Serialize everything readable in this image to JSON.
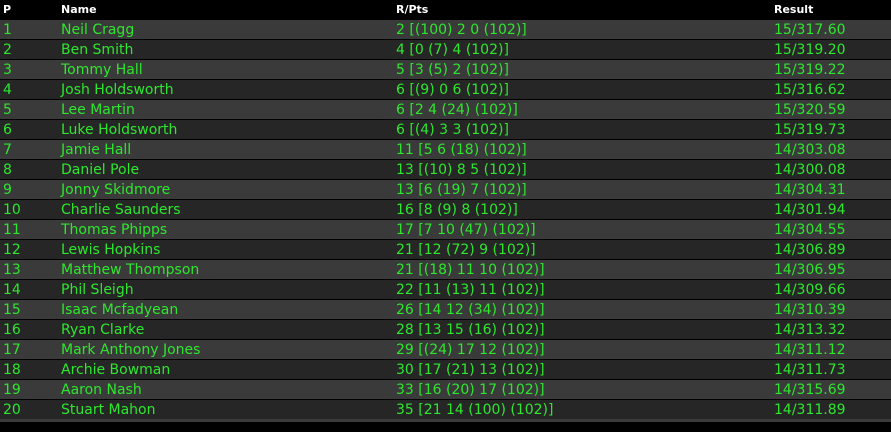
{
  "headers": {
    "pos": "P",
    "name": "Name",
    "pts": "R/Pts",
    "result": "Result"
  },
  "rows": [
    {
      "pos": "1",
      "name": "Neil Cragg",
      "pts": "2 [(100) 2 0 (102)]",
      "result": "15/317.60"
    },
    {
      "pos": "2",
      "name": "Ben Smith",
      "pts": "4 [0 (7) 4 (102)]",
      "result": "15/319.20"
    },
    {
      "pos": "3",
      "name": "Tommy Hall",
      "pts": "5 [3 (5) 2 (102)]",
      "result": "15/319.22"
    },
    {
      "pos": "4",
      "name": "Josh Holdsworth",
      "pts": "6 [(9) 0 6 (102)]",
      "result": "15/316.62"
    },
    {
      "pos": "5",
      "name": "Lee Martin",
      "pts": "6 [2 4 (24) (102)]",
      "result": "15/320.59"
    },
    {
      "pos": "6",
      "name": "Luke Holdsworth",
      "pts": "6 [(4) 3 3 (102)]",
      "result": "15/319.73"
    },
    {
      "pos": "7",
      "name": "Jamie Hall",
      "pts": "11 [5 6 (18) (102)]",
      "result": "14/303.08"
    },
    {
      "pos": "8",
      "name": "Daniel Pole",
      "pts": "13 [(10) 8 5 (102)]",
      "result": "14/300.08"
    },
    {
      "pos": "9",
      "name": "Jonny Skidmore",
      "pts": "13 [6 (19) 7 (102)]",
      "result": "14/304.31"
    },
    {
      "pos": "10",
      "name": "Charlie Saunders",
      "pts": "16 [8 (9) 8 (102)]",
      "result": "14/301.94"
    },
    {
      "pos": "11",
      "name": "Thomas Phipps",
      "pts": "17 [7 10 (47) (102)]",
      "result": "14/304.55"
    },
    {
      "pos": "12",
      "name": "Lewis Hopkins",
      "pts": "21 [12 (72) 9 (102)]",
      "result": "14/306.89"
    },
    {
      "pos": "13",
      "name": "Matthew Thompson",
      "pts": "21 [(18) 11 10 (102)]",
      "result": "14/306.95"
    },
    {
      "pos": "14",
      "name": "Phil Sleigh",
      "pts": "22 [11 (13) 11 (102)]",
      "result": "14/309.66"
    },
    {
      "pos": "15",
      "name": "Isaac Mcfadyean",
      "pts": "26 [14 12 (34) (102)]",
      "result": "14/310.39"
    },
    {
      "pos": "16",
      "name": "Ryan Clarke",
      "pts": "28 [13 15 (16) (102)]",
      "result": "14/313.32"
    },
    {
      "pos": "17",
      "name": "Mark Anthony Jones",
      "pts": "29 [(24) 17 12 (102)]",
      "result": "14/311.12"
    },
    {
      "pos": "18",
      "name": "Archie Bowman",
      "pts": "30 [17 (21) 13 (102)]",
      "result": "14/311.73"
    },
    {
      "pos": "19",
      "name": "Aaron Nash",
      "pts": "33 [16 (20) 17 (102)]",
      "result": "14/315.69"
    },
    {
      "pos": "20",
      "name": "Stuart Mahon",
      "pts": "35 [21 14 (100) (102)]",
      "result": "14/311.89"
    }
  ]
}
